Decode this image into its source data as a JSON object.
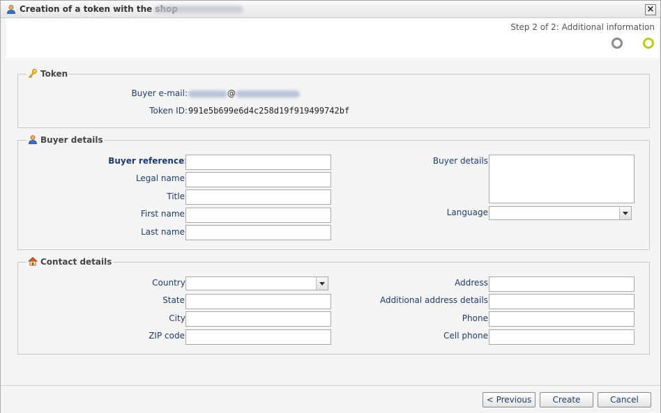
{
  "window": {
    "title": "Creation of a token with the shop",
    "close_glyph": "×",
    "title_icon": "user-icon",
    "close_icon": "close-icon"
  },
  "stepper": {
    "label": "Step 2 of 2: Additional information",
    "steps": [
      {
        "state": "done",
        "color": "#8a8a8a"
      },
      {
        "state": "current",
        "color": "#b8cc1a"
      }
    ]
  },
  "token_section": {
    "legend": "Token",
    "icon": "key-icon",
    "email_label": "Buyer e-mail:",
    "email_at": "@",
    "token_label": "Token ID:",
    "token_value": "991e5b699e6d4c258d19f919499742bf"
  },
  "buyer_section": {
    "legend": "Buyer details",
    "icon": "user-icon",
    "reference_label": "Buyer reference:",
    "legal_name_label": "Legal name:",
    "title_label": "Title:",
    "first_name_label": "First name:",
    "last_name_label": "Last name:",
    "details_label": "Buyer details:",
    "language_label": "Language:"
  },
  "contact_section": {
    "legend": "Contact details",
    "icon": "home-icon",
    "country_label": "Country:",
    "state_label": "State:",
    "city_label": "City:",
    "zip_label": "ZIP code:",
    "address_label": "Address:",
    "additional_address_label": "Additional address details:",
    "phone_label": "Phone:",
    "cell_phone_label": "Cell phone:"
  },
  "footer": {
    "previous_label": "< Previous",
    "create_label": "Create",
    "cancel_label": "Cancel"
  }
}
